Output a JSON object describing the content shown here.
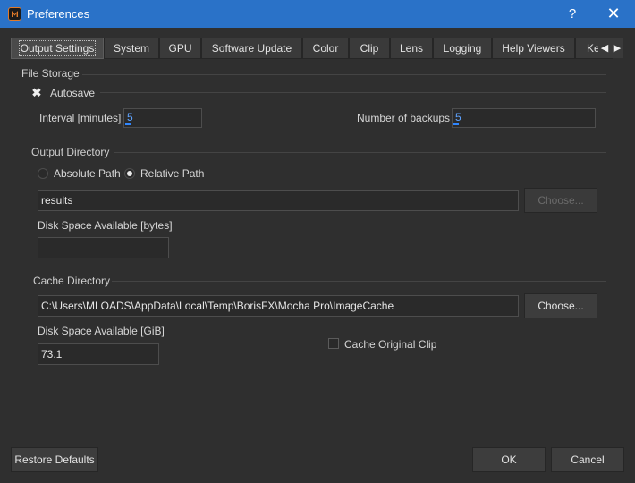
{
  "window": {
    "title": "Preferences",
    "help_glyph": "?",
    "close_glyph": "✕",
    "app_icon": "mocha-logo-icon"
  },
  "tabs": [
    {
      "label": "Output Settings",
      "active": true
    },
    {
      "label": "System"
    },
    {
      "label": "GPU"
    },
    {
      "label": "Software Update"
    },
    {
      "label": "Color"
    },
    {
      "label": "Clip"
    },
    {
      "label": "Lens"
    },
    {
      "label": "Logging"
    },
    {
      "label": "Help Viewers"
    },
    {
      "label": "Ke"
    }
  ],
  "tab_scroll": {
    "left_glyph": "◀",
    "right_glyph": "▶"
  },
  "file_storage": {
    "title": "File Storage",
    "autosave_label": "Autosave",
    "autosave_checked": true,
    "autosave_glyph": "✖",
    "interval_label": "Interval [minutes]",
    "interval_value": "5",
    "backups_label": "Number of backups",
    "backups_value": "5"
  },
  "output_directory": {
    "title": "Output Directory",
    "radio_absolute": "Absolute Path",
    "radio_relative": "Relative Path",
    "selected": "Relative Path",
    "path_value": "results",
    "choose_label": "Choose...",
    "disk_label": "Disk Space Available [bytes]",
    "disk_value": ""
  },
  "cache_directory": {
    "title": "Cache Directory",
    "path_value": "C:\\Users\\MLOADS\\AppData\\Local\\Temp\\BorisFX\\Mocha Pro\\ImageCache",
    "choose_label": "Choose...",
    "disk_label": "Disk Space Available [GiB]",
    "disk_value": "73.1",
    "cache_original_label": "Cache Original Clip",
    "cache_original_checked": false
  },
  "footer": {
    "restore_label": "Restore Defaults",
    "ok_label": "OK",
    "cancel_label": "Cancel"
  },
  "colors": {
    "titlebar": "#2a72c8",
    "background": "#2f2f2f",
    "accent": "#2f86ff"
  }
}
